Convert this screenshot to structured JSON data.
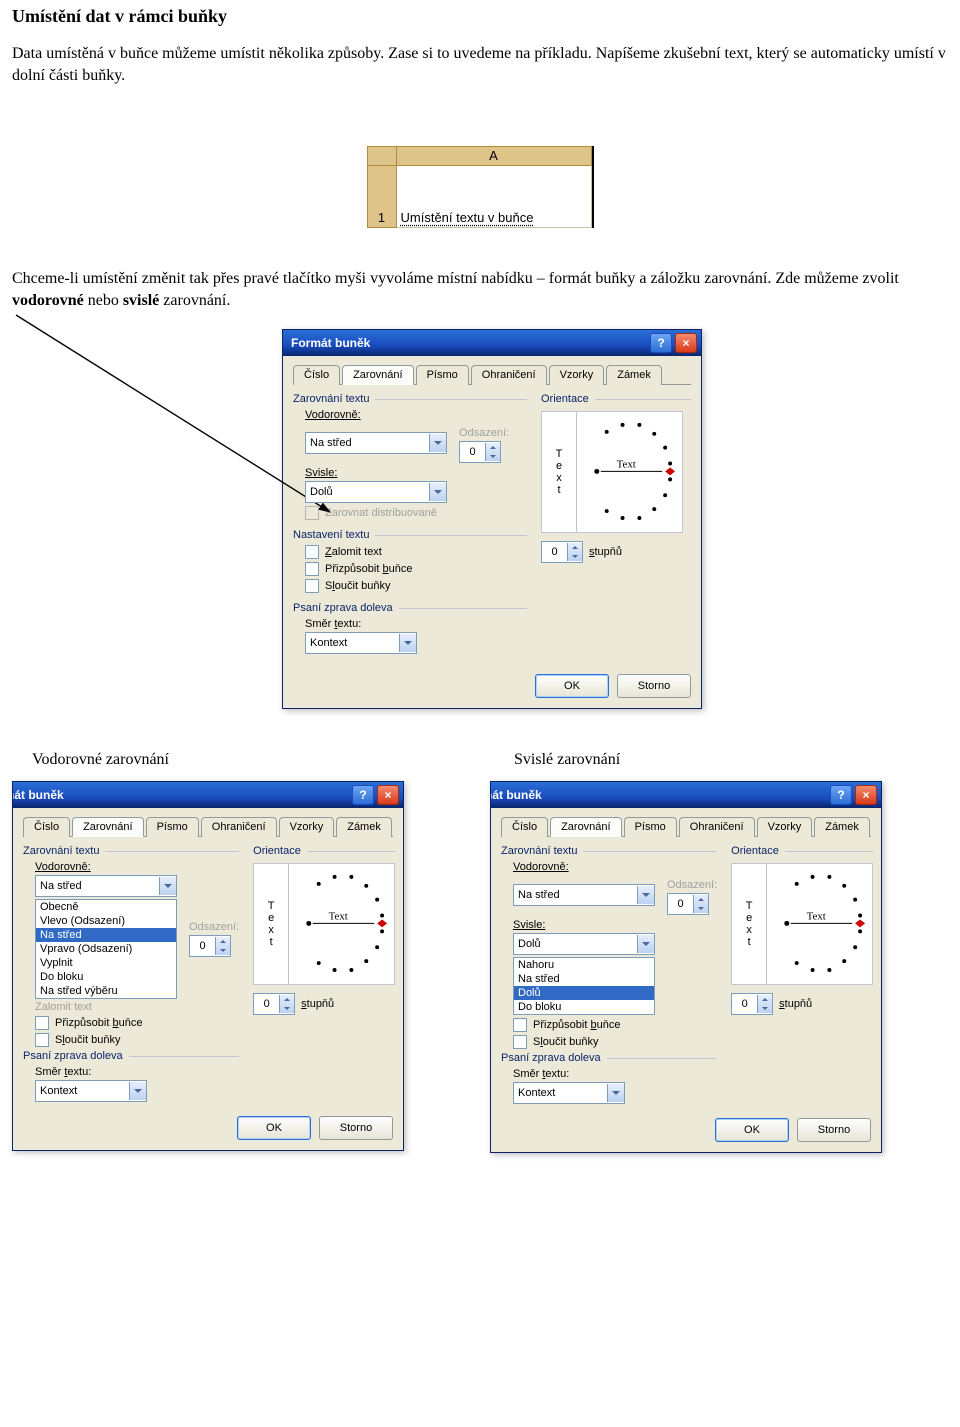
{
  "doc": {
    "title": "Umístění dat v rámci buňky",
    "para1": "Data umístěná v buňce můžeme umístit několika způsoby. Zase si to uvedeme na příkladu. Napíšeme zkušební text, který se automaticky umístí v dolní části buňky.",
    "para2_a": "Chceme-li umístění změnit tak přes pravé tlačítko myši vyvoláme místní nabídku – formát buňky a záložku zarovnání. Zde můžeme zvolit ",
    "para2_b": "vodorovné",
    "para2_c": " nebo ",
    "para2_d": "svislé",
    "para2_e": " zarovnání.",
    "caption_h": "Vodorovné zarovnání",
    "caption_v": "Svislé zarovnání"
  },
  "excel": {
    "col": "A",
    "row": "1",
    "cell": "Umístění textu v buňce"
  },
  "dlg": {
    "title": "Formát buněk",
    "title_cut": "rmát buněk",
    "tabs": [
      "Číslo",
      "Zarovnání",
      "Písmo",
      "Ohraničení",
      "Vzorky",
      "Zámek"
    ],
    "grp_align": "Zarovnání textu",
    "lbl_h": "Vodorovně:",
    "val_h": "Na střed",
    "lbl_offset": "Odsazení:",
    "val_offset": "0",
    "lbl_v": "Svisle:",
    "val_v": "Dolů",
    "chk_dist": "Zarovnat distribuovaně",
    "grp_textctl": "Nastavení textu",
    "chk_wrap": "Zalomit text",
    "chk_shrink": "Přizpůsobit buňce",
    "chk_merge": "Sloučit buňky",
    "grp_rtl": "Psaní zprava doleva",
    "lbl_dir": "Směr textu:",
    "val_dir": "Kontext",
    "grp_orient": "Orientace",
    "orient_t": "T",
    "orient_e": "e",
    "orient_x": "x",
    "orient_t2": "t",
    "orient_label": "Text",
    "deg_val": "0",
    "deg_lbl": "stupňů",
    "ok": "OK",
    "cancel": "Storno",
    "h_opts": [
      "Obecně",
      "Vlevo (Odsazení)",
      "Na střed",
      "Vpravo (Odsazení)",
      "Vyplnit",
      "Do bloku",
      "Na střed výběru"
    ],
    "v_opts": [
      "Nahoru",
      "Na střed",
      "Dolů",
      "Do bloku"
    ],
    "nas_prefix": "Nas",
    "lbl_wrap_cut": "Zalomit text",
    "psani_cut": "Psaní zprava doleva"
  }
}
